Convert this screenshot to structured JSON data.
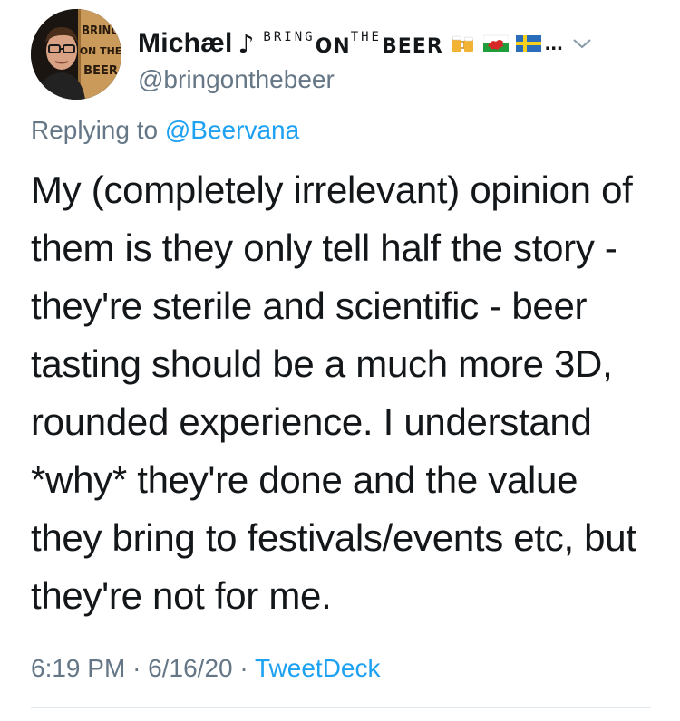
{
  "author": {
    "display_name": "Michæl",
    "note_symbol": "♪",
    "bio_tag_sup_left": "BRING",
    "bio_tag_mid": "ON",
    "bio_tag_sup_right": "THE",
    "bio_tag_end": "BEER",
    "ellipsis": "...",
    "handle": "@bringonthebeer",
    "avatar_sign_lines": [
      "BRING",
      "ON THE",
      "BEER"
    ],
    "icons": [
      "beer-mugs-icon",
      "wales-flag-icon",
      "sweden-flag-icon",
      "chevron-down-icon"
    ]
  },
  "reply": {
    "prefix": "Replying to",
    "mention": "@Beervana"
  },
  "tweet": {
    "lines": [
      "My (completely irrelevant) opinion of",
      "them is they only tell half the story -",
      "they're sterile and scientific - beer",
      "tasting should be a much more 3D,",
      "rounded experience. I understand",
      "*why* they're done and the value",
      "they bring to festivals/events etc, but",
      "they're not for me."
    ]
  },
  "meta": {
    "time": "6:19 PM",
    "separator": "·",
    "date": "6/16/20",
    "source": "TweetDeck"
  },
  "colors": {
    "text": "#14171a",
    "secondary": "#657786",
    "link": "#1da1f2",
    "divider": "#e1e8ed"
  }
}
